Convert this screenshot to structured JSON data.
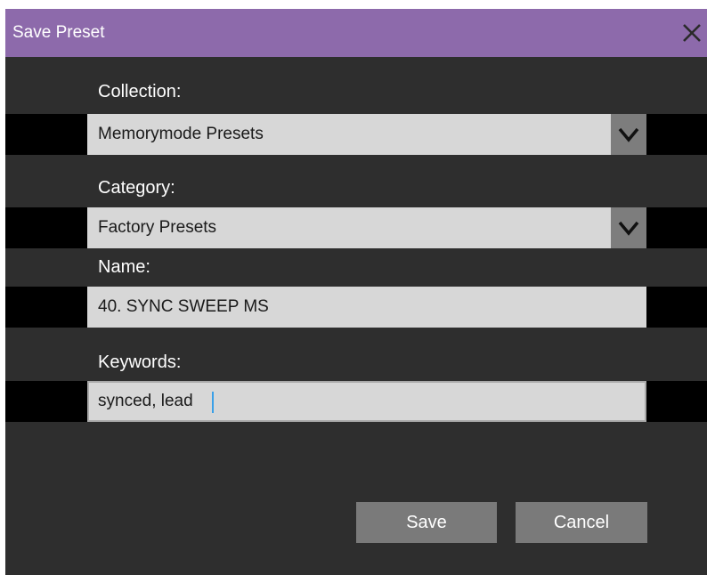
{
  "dialog": {
    "title": "Save Preset",
    "close_icon": "close-icon"
  },
  "collection": {
    "label": "Collection:",
    "value": "Memorymode Presets",
    "arrow_icon": "chevron-down-icon"
  },
  "category": {
    "label": "Category:",
    "value": "Factory Presets",
    "arrow_icon": "chevron-down-icon"
  },
  "name": {
    "label": "Name:",
    "value": "40. SYNC SWEEP MS"
  },
  "keywords": {
    "label": "Keywords:",
    "value": "synced, lead"
  },
  "buttons": {
    "save_label": "Save",
    "cancel_label": "Cancel"
  },
  "colors": {
    "titlebar": "#8d6aab",
    "dialog_background": "#2e2e2e",
    "field_background": "#d7d7d7",
    "button_background": "#7a7a7a",
    "caret": "#3aa0e8"
  }
}
